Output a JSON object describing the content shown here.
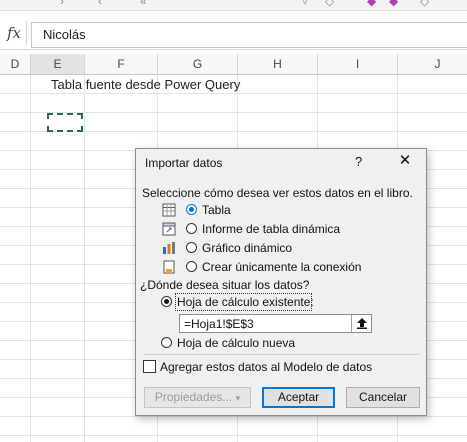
{
  "formula_bar": {
    "fx_label": "fx",
    "value": "Nicolás"
  },
  "columns": [
    "D",
    "E",
    "F",
    "G",
    "H",
    "I",
    "J"
  ],
  "sheet": {
    "cell_text": "Tabla fuente desde Power Query"
  },
  "dialog": {
    "title": "Importar datos",
    "help": "?",
    "close": "✕",
    "section1": "Seleccione cómo desea ver estos datos en el libro.",
    "view_options": [
      {
        "label": "Tabla",
        "selected": true,
        "icon": "table-icon"
      },
      {
        "label": "Informe de tabla dinámica",
        "selected": false,
        "icon": "pivot-table-icon"
      },
      {
        "label": "Gráfico dinámico",
        "selected": false,
        "icon": "pivot-chart-icon"
      },
      {
        "label": "Crear únicamente la conexión",
        "selected": false,
        "icon": "connection-icon"
      }
    ],
    "section2": "¿Dónde desea situar los datos?",
    "location_options": [
      {
        "label": "Hoja de cálculo existente:",
        "selected": true
      },
      {
        "label": "Hoja de cálculo nueva",
        "selected": false
      }
    ],
    "reference": "=Hoja1!$E$3",
    "data_model_checkbox": {
      "label": "Agregar estos datos al Modelo de datos",
      "checked": false
    },
    "buttons": {
      "properties": "Propiedades...",
      "accept": "Aceptar",
      "cancel": "Cancelar"
    }
  }
}
